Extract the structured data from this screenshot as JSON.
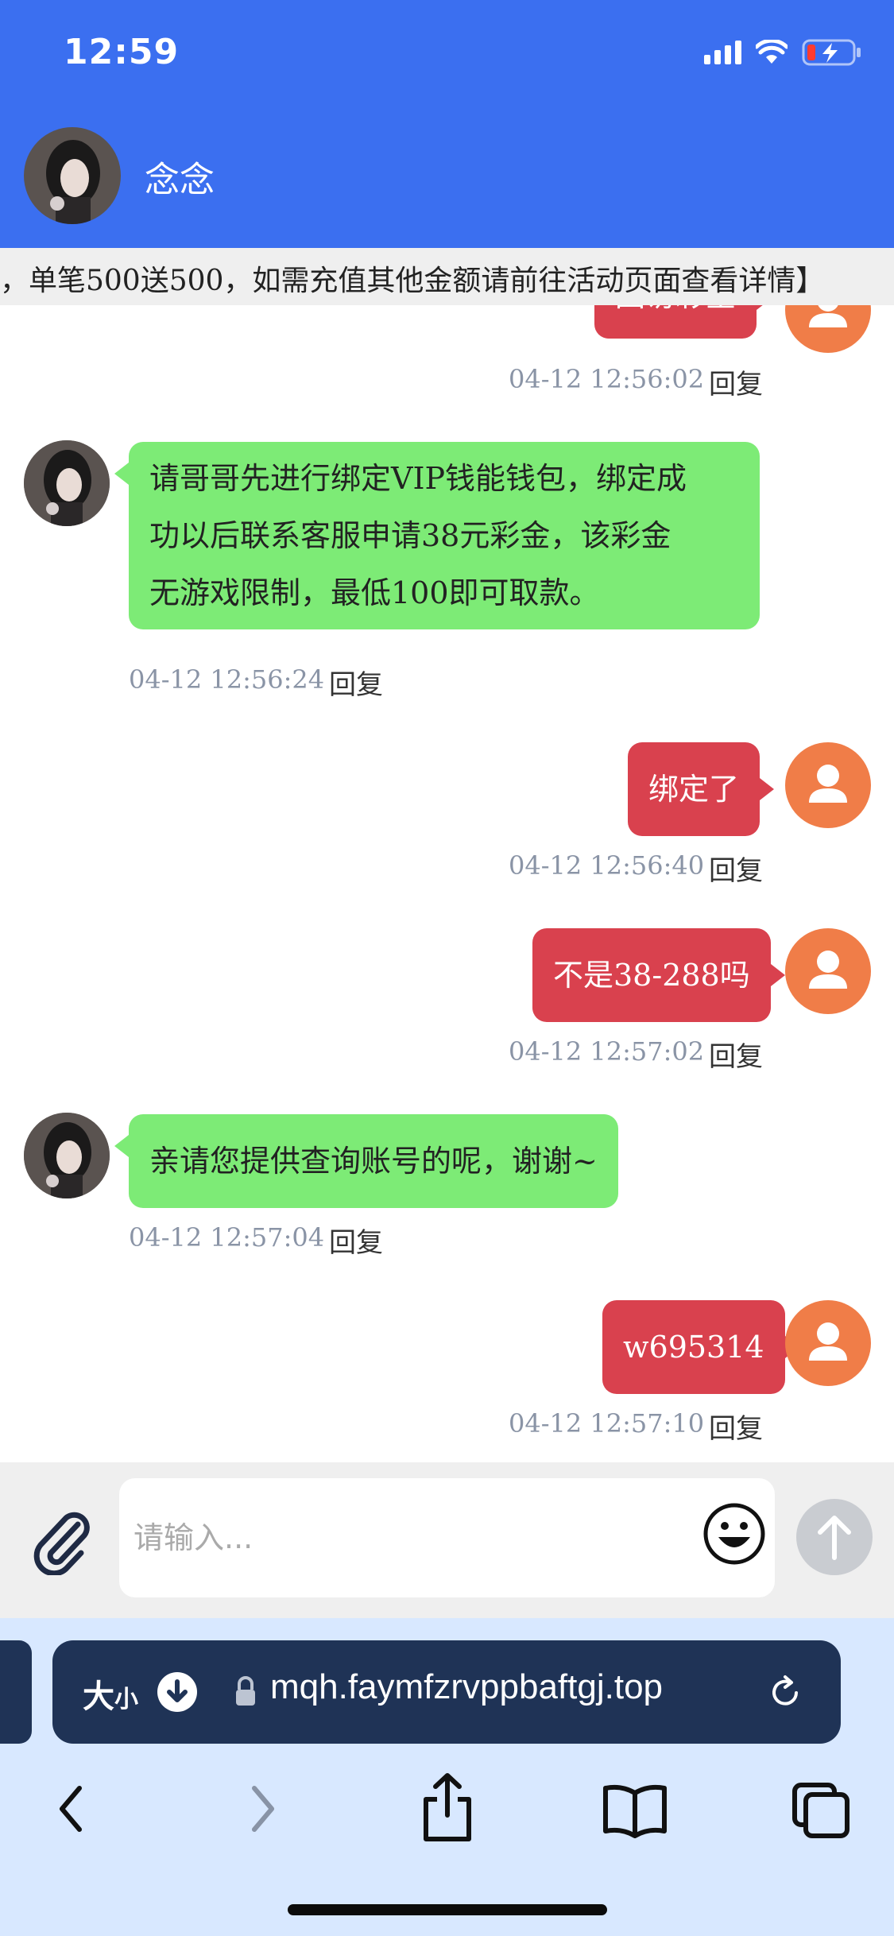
{
  "status_bar": {
    "time": "12:59"
  },
  "header": {
    "contact_name": "念念"
  },
  "marquee": {
    "text": "，单笔500送500，如需充值其他金额请前往活动页面查看详情】"
  },
  "messages": [
    {
      "side": "out",
      "text": "回访彩金",
      "time": "04-12 12:56:02",
      "reply": "回复"
    },
    {
      "side": "in",
      "lines": [
        "请哥哥先进行绑定VIP钱能钱包，绑定成",
        "功以后联系客服申请38元彩金，该彩金",
        "无游戏限制，最低100即可取款。"
      ],
      "time": "04-12 12:56:24",
      "reply": "回复"
    },
    {
      "side": "out",
      "text": "绑定了",
      "time": "04-12 12:56:40",
      "reply": "回复"
    },
    {
      "side": "out",
      "text": "不是38-288吗",
      "time": "04-12 12:57:02",
      "reply": "回复"
    },
    {
      "side": "in",
      "text": "亲请您提供查询账号的呢，谢谢~",
      "time": "04-12 12:57:04",
      "reply": "回复"
    },
    {
      "side": "out",
      "text": "w695314",
      "time": "04-12 12:57:10",
      "reply": "回复"
    }
  ],
  "input": {
    "placeholder": "请输入..."
  },
  "browser": {
    "text_size_label": "大",
    "text_size_small": "小",
    "url": "mqh.faymfzrvppbaftgj.top"
  },
  "colors": {
    "header": "#3b6ff0",
    "incoming_bubble": "#7deb76",
    "outgoing_bubble": "#d9414e",
    "user_avatar": "#f07d48"
  },
  "icons": [
    "wifi-icon",
    "battery-charging-icon",
    "paperclip-icon",
    "smiley-icon",
    "send-arrow-icon",
    "download-icon",
    "lock-icon",
    "reload-icon",
    "back-icon",
    "forward-icon",
    "share-icon",
    "bookmarks-icon",
    "tabs-icon"
  ]
}
